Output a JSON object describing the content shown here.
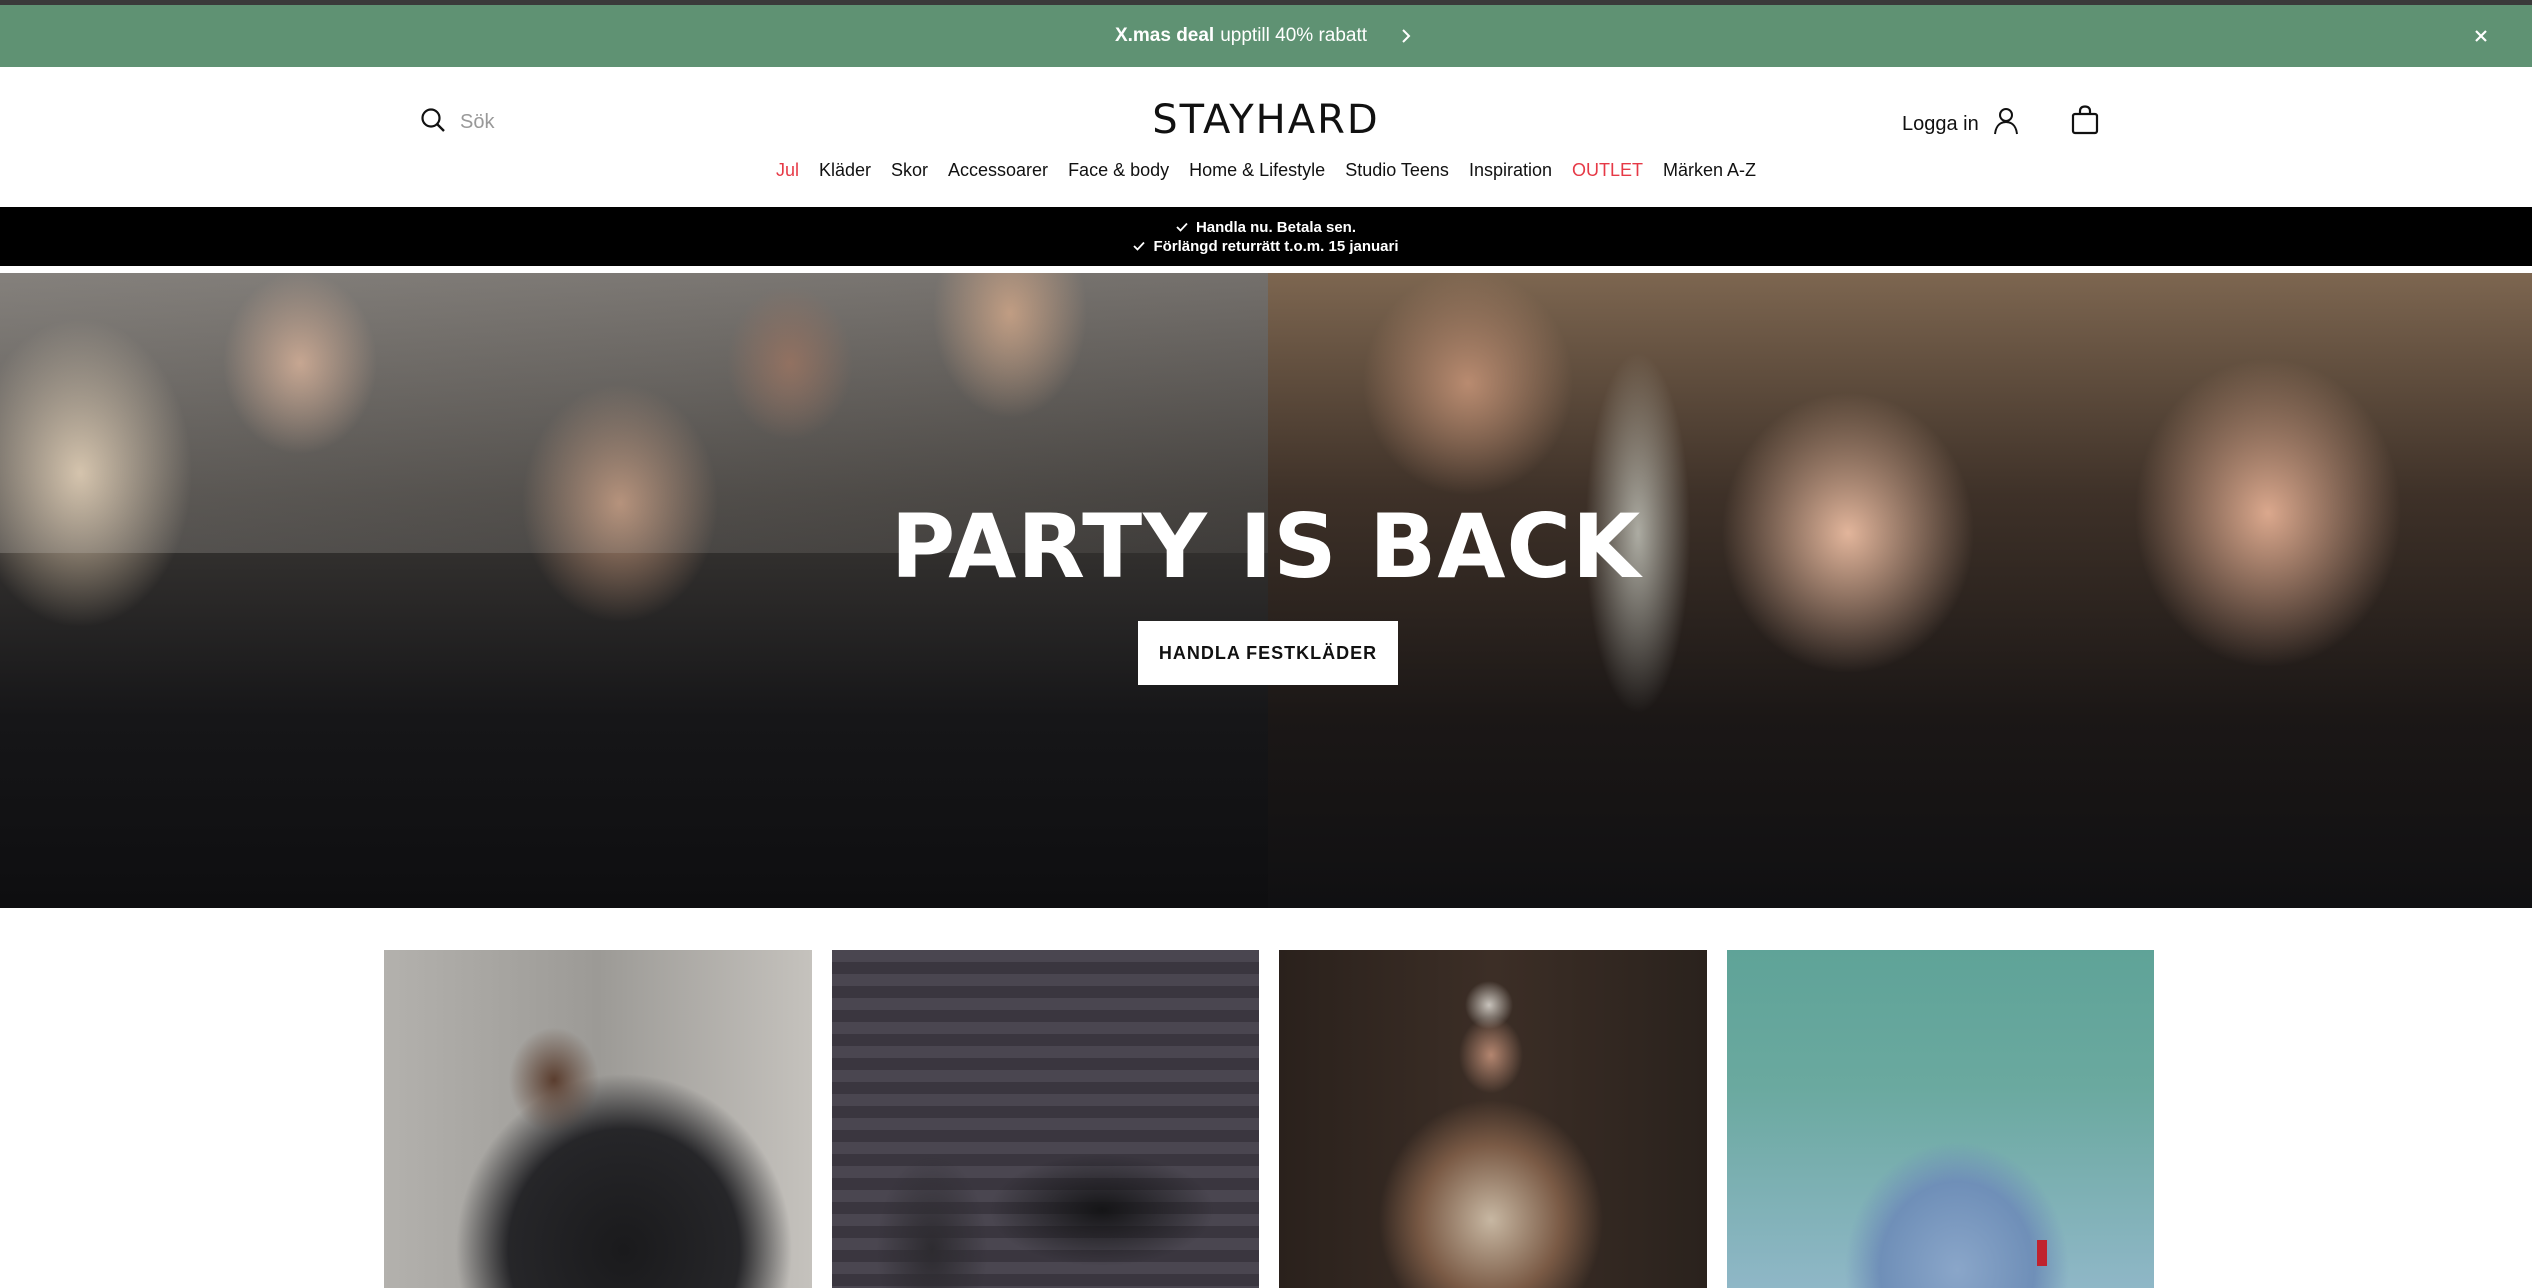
{
  "promo": {
    "bold": "X.mas deal",
    "text": "upptill 40% rabatt",
    "bg_color": "#5f9273"
  },
  "header": {
    "search_placeholder": "Sök",
    "logo": "STAYHARD",
    "login_label": "Logga in"
  },
  "nav": {
    "items": [
      {
        "label": "Jul",
        "highlight": true
      },
      {
        "label": "Kläder",
        "highlight": false
      },
      {
        "label": "Skor",
        "highlight": false
      },
      {
        "label": "Accessoarer",
        "highlight": false
      },
      {
        "label": "Face & body",
        "highlight": false
      },
      {
        "label": "Home & Lifestyle",
        "highlight": false
      },
      {
        "label": "Studio Teens",
        "highlight": false
      },
      {
        "label": "Inspiration",
        "highlight": false
      },
      {
        "label": "OUTLET",
        "highlight": true
      },
      {
        "label": "Märken A-Z",
        "highlight": false
      }
    ],
    "highlight_color": "#e63946"
  },
  "usp": {
    "line1": "Handla nu. Betala sen.",
    "line2": "Förlängd returrätt t.o.m. 15 januari"
  },
  "hero": {
    "title": "PARTY IS BACK",
    "cta": "HANDLA FESTKLÄDER"
  },
  "icons": {
    "search": "search-icon",
    "user": "user-icon",
    "bag": "shopping-bag-icon",
    "chevron": "chevron-right-icon",
    "close": "close-icon",
    "check": "check-icon"
  }
}
